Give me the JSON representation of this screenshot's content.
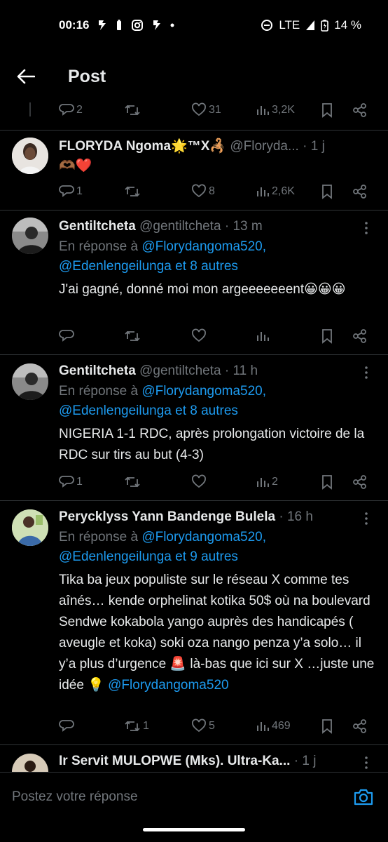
{
  "status_bar": {
    "time": "00:16",
    "network": "LTE",
    "battery": "14 %",
    "icons": [
      "bluesky-icon",
      "battery-saver-icon",
      "instagram-icon",
      "bluesky-icon",
      "dot-icon",
      "dnd-icon",
      "signal-icon",
      "battery-icon"
    ]
  },
  "header": {
    "title": "Post",
    "back_icon": "arrow-left-icon"
  },
  "colors": {
    "background": "#000000",
    "text": "#e7e9ea",
    "muted": "#71767b",
    "link": "#1d9bf0",
    "divider": "#2f3336"
  },
  "top_actions": {
    "replies": "2",
    "reposts": "",
    "likes": "31",
    "views": "3,2K"
  },
  "posts": [
    {
      "name": "FLORYDA Ngoma🌟™X🦂",
      "handle": "@Floryda...",
      "dot": "·",
      "time": "1 j",
      "reply_prefix": "",
      "mentions": "",
      "body": "🫶🏾❤️",
      "replies": "1",
      "reposts": "",
      "likes": "8",
      "views": "2,6K"
    },
    {
      "name": "Gentiltcheta",
      "handle": "@gentiltcheta",
      "dot": "·",
      "time": "13 m",
      "reply_prefix": "En réponse à ",
      "mention1": "@Florydangoma520,",
      "mention2": "@Edenlengeilunga et 8 autres",
      "body": "J'ai gagné, donné moi mon argeeeeeeent😀😀😀",
      "replies": "",
      "reposts": "",
      "likes": "",
      "views": ""
    },
    {
      "name": "Gentiltcheta",
      "handle": "@gentiltcheta",
      "dot": "·",
      "time": "11 h",
      "reply_prefix": "En réponse à ",
      "mention1": "@Florydangoma520,",
      "mention2": "@Edenlengeilunga et 8 autres",
      "body": "NIGERIA 1-1 RDC, après prolongation victoire de la RDC sur tirs au but (4-3)",
      "replies": "1",
      "reposts": "",
      "likes": "",
      "views": "2"
    },
    {
      "name": "Perycklyss Yann Bandenge Bulela",
      "handle": "",
      "dot": "·",
      "time": "16 h",
      "reply_prefix": "En réponse à ",
      "mention1": "@Florydangoma520,",
      "mention2": "@Edenlengeilunga et 9 autres",
      "body": "Tika ba jeux populiste sur le réseau X comme tes aînés… kende orphelinat kotika 50$ où na boulevard Sendwe kokabola yango auprès des handicapés ( aveugle et koka) soki oza nango penza y’a solo… il y’a plus d’urgence 🚨 là-bas que ici sur X …juste une idée 💡",
      "body_mention": "@Florydangoma520",
      "replies": "",
      "reposts": "1",
      "likes": "5",
      "views": "469"
    },
    {
      "name": "Ir Servit MULOPWE (Mks). Ultra-Ka...",
      "handle": "",
      "dot": "·",
      "time": "1 j"
    }
  ],
  "compose": {
    "placeholder": "Postez votre réponse",
    "camera_icon": "camera-icon"
  }
}
